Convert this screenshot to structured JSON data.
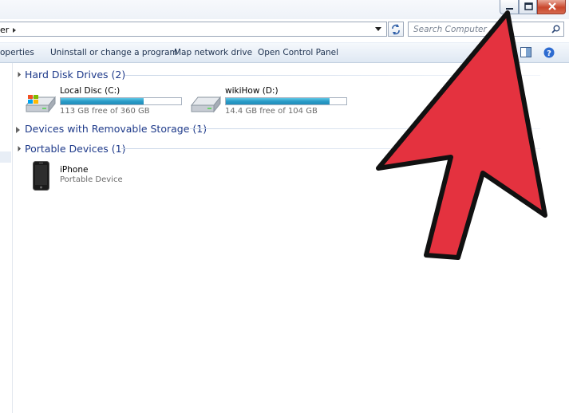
{
  "address": {
    "crumb": "er"
  },
  "search": {
    "placeholder": "Search Computer"
  },
  "toolbar": {
    "properties": "operties",
    "uninstall": "Uninstall or change a program",
    "map_drive": "Map network drive",
    "control_panel": "Open Control Panel"
  },
  "groups": {
    "hard_disk": {
      "title": "Hard Disk Drives (2)",
      "drives": [
        {
          "name": "Local Disc (C:)",
          "free_text": "113 GB free of 360 GB",
          "used_fraction": 0.69
        },
        {
          "name": "wikiHow (D:)",
          "free_text": "14.4 GB free of 104 GB",
          "used_fraction": 0.86
        }
      ]
    },
    "removable": {
      "title": "Devices with Removable Storage (1)"
    },
    "portable": {
      "title": "Portable Devices (1)",
      "devices": [
        {
          "name": "iPhone",
          "type": "Portable Device"
        }
      ]
    }
  },
  "icons": {
    "minimize": "minimize-icon",
    "maximize": "maximize-icon",
    "close": "close-icon",
    "refresh": "refresh-icon",
    "search": "search-icon",
    "preview_pane": "preview-pane-icon",
    "help": "help-icon",
    "drive_c": "windows-drive-icon",
    "drive_d": "hard-drive-icon",
    "iphone": "iphone-icon",
    "annotation": "red-arrow-icon"
  },
  "colors": {
    "arrow": "#e4323f",
    "bar_fill": "#2a9bc7",
    "group_title": "#1e3a8a"
  }
}
